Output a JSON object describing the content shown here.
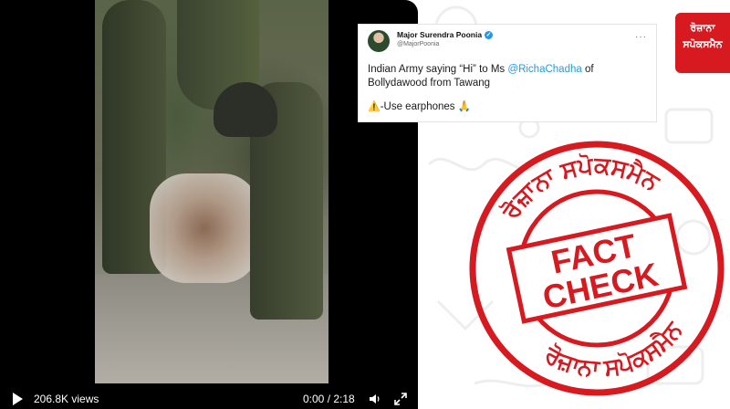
{
  "video": {
    "views": "206.8K views",
    "time": "0:00 / 2:18"
  },
  "tweet": {
    "author_name": "Major Surendra Poonia",
    "author_handle": "@MajorPoonia",
    "text_part1": "Indian Army saying “Hi” to Ms ",
    "mention": "@RichaChadha",
    "text_part2": " of Bollydawood from Tawang",
    "note": "-Use earphones 🙏",
    "more": "···",
    "verified_glyph": "✓",
    "warning_glyph": "⚠️"
  },
  "logo": {
    "line1": "ਰੋਜ਼ਾਨਾ",
    "line2": "ਸਪੋਕਸਮੈਨ"
  },
  "stamp": {
    "word1": "FACT",
    "word2": "CHECK",
    "ring_top": "ਰੋਜ਼ਾਨਾ ਸਪੋਕਸਮੈਨ",
    "ring_bottom": "ਰੋਜ਼ਾਨਾ ਸਪੋਕਸਮੈਨ",
    "color": "#d71920"
  },
  "icons": {
    "play": "play-icon",
    "volume": "volume-icon",
    "fullscreen": "fullscreen-icon",
    "verified": "verified-icon",
    "warning": "warning-icon"
  }
}
